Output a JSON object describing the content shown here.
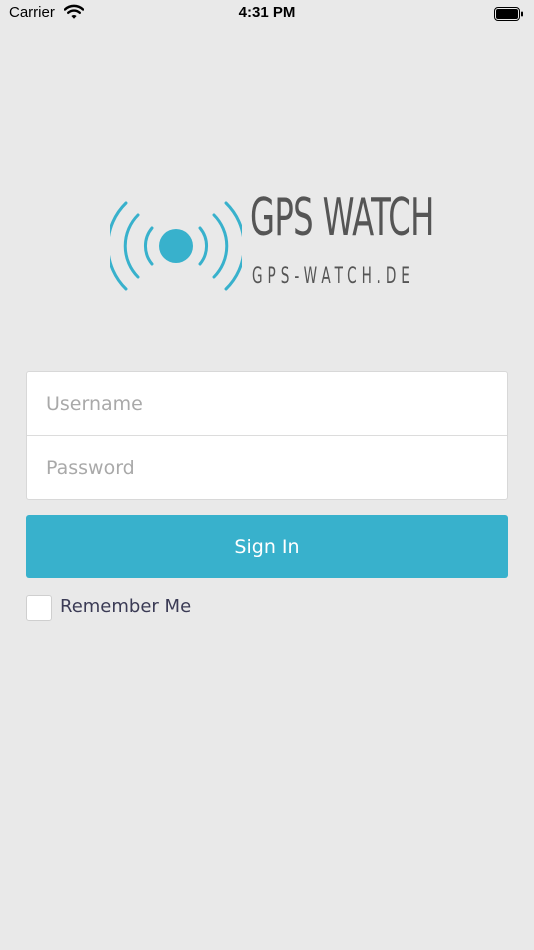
{
  "status_bar": {
    "carrier": "Carrier",
    "time": "4:31 PM",
    "wifi_icon": "wifi-icon",
    "battery_icon": "battery-icon"
  },
  "logo": {
    "title": "GPS WATCH",
    "subtitle": "GPS-WATCH.DE",
    "icon": "gps-signal-icon",
    "accent_color": "#38b1cc",
    "text_color": "#555555"
  },
  "login_form": {
    "username_placeholder": "Username",
    "username_value": "",
    "password_placeholder": "Password",
    "password_value": "",
    "sign_in_label": "Sign In",
    "remember_label": "Remember Me",
    "remember_checked": false
  },
  "colors": {
    "background": "#e9e9e9",
    "button": "#38b1cc",
    "button_text": "#ffffff"
  }
}
